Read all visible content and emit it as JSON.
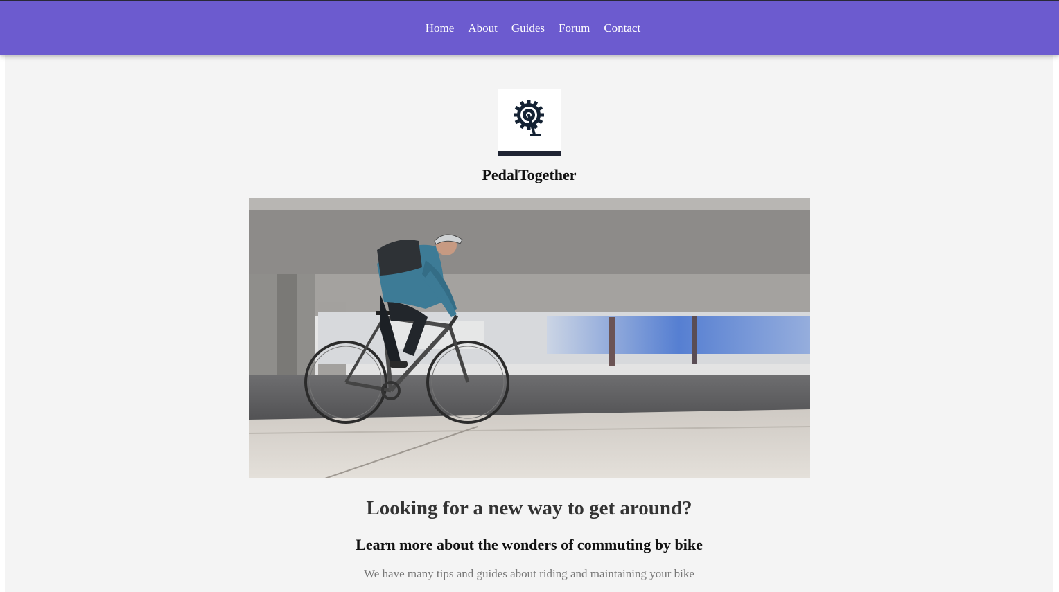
{
  "nav": {
    "items": [
      {
        "label": "Home"
      },
      {
        "label": "About"
      },
      {
        "label": "Guides"
      },
      {
        "label": "Forum"
      },
      {
        "label": "Contact"
      }
    ]
  },
  "brand": {
    "logo_icon": "bike-crank-gear-icon",
    "name": "PedalTogether"
  },
  "hero": {
    "image": "cyclist-commuting-photo"
  },
  "content": {
    "headline": "Looking for a new way to get around?",
    "subheadline": "Learn more about the wonders of commuting by bike",
    "tagline": "We have many tips and guides about riding and maintaining your bike"
  },
  "colors": {
    "navbar": "#6c5bcf",
    "page_background": "#f4f4f4"
  }
}
